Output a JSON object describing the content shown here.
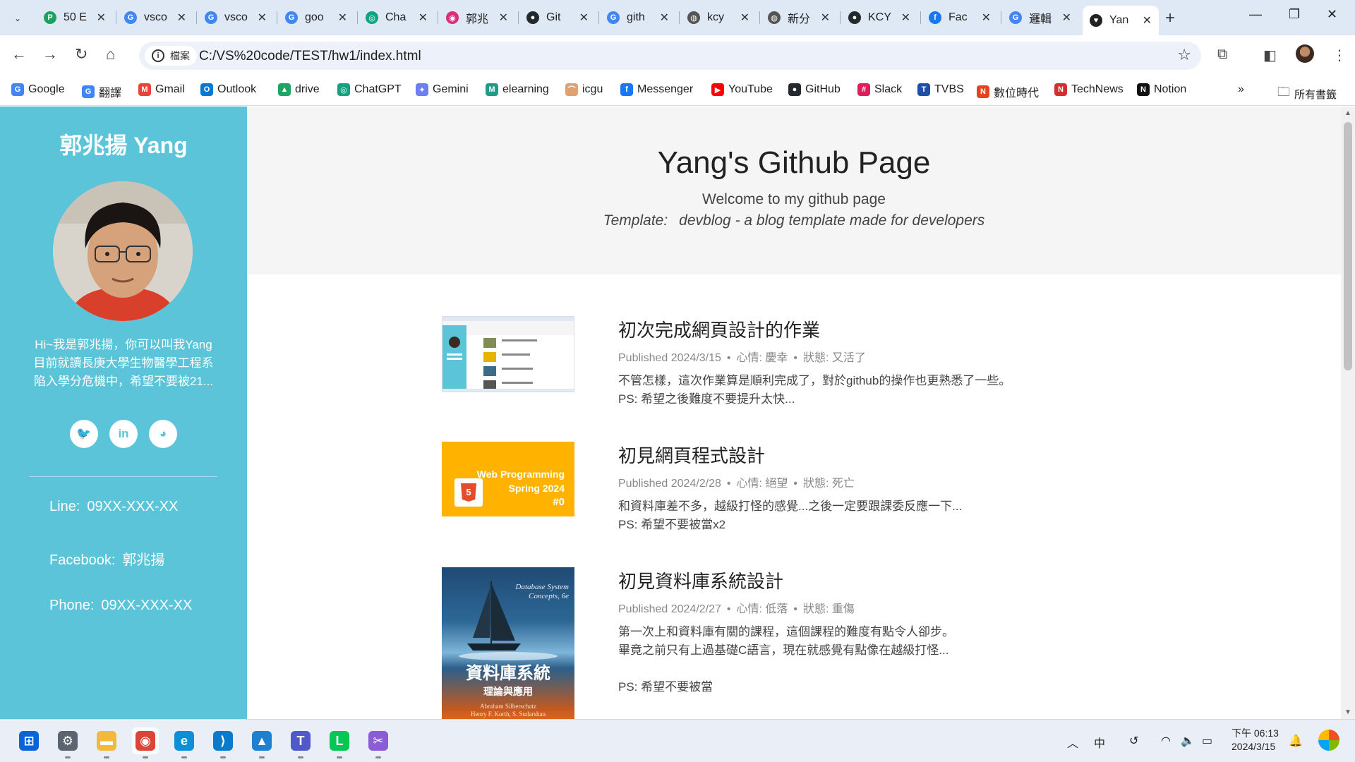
{
  "browser": {
    "tabs": [
      {
        "title": "50 E",
        "fav_color": "#1aa260",
        "fav_glyph": "P"
      },
      {
        "title": "vsco",
        "fav_color": "#4285f4",
        "fav_glyph": "G"
      },
      {
        "title": "vsco",
        "fav_color": "#4285f4",
        "fav_glyph": "G"
      },
      {
        "title": "goo",
        "fav_color": "#4285f4",
        "fav_glyph": "G"
      },
      {
        "title": "Cha",
        "fav_color": "#10a37f",
        "fav_glyph": "◎"
      },
      {
        "title": "郭兆",
        "fav_color": "#dd2a7b",
        "fav_glyph": "◉"
      },
      {
        "title": "Git",
        "fav_color": "#24292f",
        "fav_glyph": "●"
      },
      {
        "title": "gith",
        "fav_color": "#4285f4",
        "fav_glyph": "G"
      },
      {
        "title": "kcy",
        "fav_color": "#555555",
        "fav_glyph": "◍"
      },
      {
        "title": "新分",
        "fav_color": "#555555",
        "fav_glyph": "◍"
      },
      {
        "title": "KCY",
        "fav_color": "#24292f",
        "fav_glyph": "●"
      },
      {
        "title": "Fac",
        "fav_color": "#1877f2",
        "fav_glyph": "f"
      },
      {
        "title": "邏輯",
        "fav_color": "#4285f4",
        "fav_glyph": "G"
      },
      {
        "title": "Yan",
        "fav_color": "#222222",
        "fav_glyph": "♥"
      }
    ],
    "address": {
      "chip_label": "檔案",
      "url": "C:/VS%20code/TEST/hw1/index.html"
    },
    "bookmarks": [
      {
        "label": "Google",
        "color": "#4285f4",
        "glyph": "G"
      },
      {
        "label": "翻譯",
        "color": "#4285f4",
        "glyph": "G"
      },
      {
        "label": "Gmail",
        "color": "#ea4335",
        "glyph": "M"
      },
      {
        "label": "Outlook",
        "color": "#0078d4",
        "glyph": "O"
      },
      {
        "label": "drive",
        "color": "#1fa463",
        "glyph": "▲"
      },
      {
        "label": "ChatGPT",
        "color": "#10a37f",
        "glyph": "◎"
      },
      {
        "label": "Gemini",
        "color": "#6c7ff2",
        "glyph": "✦"
      },
      {
        "label": "elearning",
        "color": "#1e9e86",
        "glyph": "M"
      },
      {
        "label": "icgu",
        "color": "#e0a070",
        "glyph": "⌒"
      },
      {
        "label": "Messenger",
        "color": "#1877f2",
        "glyph": "f"
      },
      {
        "label": "YouTube",
        "color": "#ff0000",
        "glyph": "▶"
      },
      {
        "label": "GitHub",
        "color": "#24292f",
        "glyph": "●"
      },
      {
        "label": "Slack",
        "color": "#e01e5a",
        "glyph": "#"
      },
      {
        "label": "TVBS",
        "color": "#1d4ea8",
        "glyph": "T"
      },
      {
        "label": "數位時代",
        "color": "#e8431f",
        "glyph": "N"
      },
      {
        "label": "TechNews",
        "color": "#d32f2f",
        "glyph": "N"
      },
      {
        "label": "Notion",
        "color": "#111111",
        "glyph": "N"
      }
    ],
    "all_bookmarks_label": "所有書籤"
  },
  "sidebar": {
    "name": "郭兆揚 Yang",
    "bio": [
      "Hi~我是郭兆揚，你可以叫我Yang",
      "目前就讀長庚大學生物醫學工程系",
      "陷入學分危機中，希望不要被21..."
    ],
    "socials": [
      {
        "name": "twitter",
        "glyph": "🐦"
      },
      {
        "name": "linkedin",
        "glyph": "in"
      },
      {
        "name": "github",
        "glyph": "◕"
      }
    ],
    "contacts": [
      {
        "label": "Line:",
        "value": "09XX-XXX-XX"
      },
      {
        "label": "Facebook:",
        "value": "郭兆揚"
      },
      {
        "label": "Phone:",
        "value": "09XX-XXX-XX"
      }
    ]
  },
  "hero": {
    "title": "Yang's Github Page",
    "subtitle": "Welcome to my github page",
    "template_label": "Template:",
    "template_text": "devblog - a blog template made for developers"
  },
  "posts": [
    {
      "title": "初次完成網頁設計的作業",
      "date": "Published 2024/3/15",
      "mood": "心情: 慶幸",
      "status": "狀態: 又活了",
      "lines": [
        "不管怎樣，這次作業算是順利完成了，對於github的操作也更熟悉了一些。",
        "PS: 希望之後難度不要提升太快..."
      ]
    },
    {
      "title": "初見網頁程式設計",
      "date": "Published 2024/2/28",
      "mood": "心情: 絕望",
      "status": "狀態: 死亡",
      "lines": [
        "和資料庫差不多，越級打怪的感覺...之後一定要跟課委反應一下...",
        "PS: 希望不要被當x2"
      ],
      "thumb_text": [
        "Web Programming",
        "Spring 2024",
        "#0"
      ]
    },
    {
      "title": "初見資料庫系統設計",
      "date": "Published 2024/2/27",
      "mood": "心情: 低落",
      "status": "狀態: 重傷",
      "lines": [
        "第一次上和資料庫有關的課程，這個課程的難度有點令人卻步。",
        "畢竟之前只有上過基礎C語言，現在就感覺有點像在越級打怪...",
        "",
        "PS: 希望不要被當"
      ],
      "thumb_text": [
        "Database System",
        "Concepts, 6e",
        "資料庫系統",
        "理論與應用",
        "Abraham Silberschatz",
        "Henry F. Korth, S. Sudarshan"
      ]
    }
  ],
  "taskbar": {
    "apps": [
      {
        "name": "start",
        "glyph": "⊞",
        "color": "#0a64d8"
      },
      {
        "name": "settings",
        "glyph": "⚙",
        "color": "#5b6470"
      },
      {
        "name": "file-explorer",
        "glyph": "▬",
        "color": "#f2b93b"
      },
      {
        "name": "chrome",
        "glyph": "◉",
        "color": "#db4437"
      },
      {
        "name": "edge",
        "glyph": "e",
        "color": "#0c8fd6"
      },
      {
        "name": "vscode",
        "glyph": "⟩",
        "color": "#0a7acc"
      },
      {
        "name": "photos",
        "glyph": "▲",
        "color": "#1f7fd0"
      },
      {
        "name": "teams",
        "glyph": "T",
        "color": "#5059c9"
      },
      {
        "name": "line",
        "glyph": "L",
        "color": "#06c755"
      },
      {
        "name": "snipping-tool",
        "glyph": "✂",
        "color": "#8a5cd6"
      }
    ],
    "ime": "中",
    "clock_time": "下午 06:13",
    "clock_date": "2024/3/15"
  }
}
